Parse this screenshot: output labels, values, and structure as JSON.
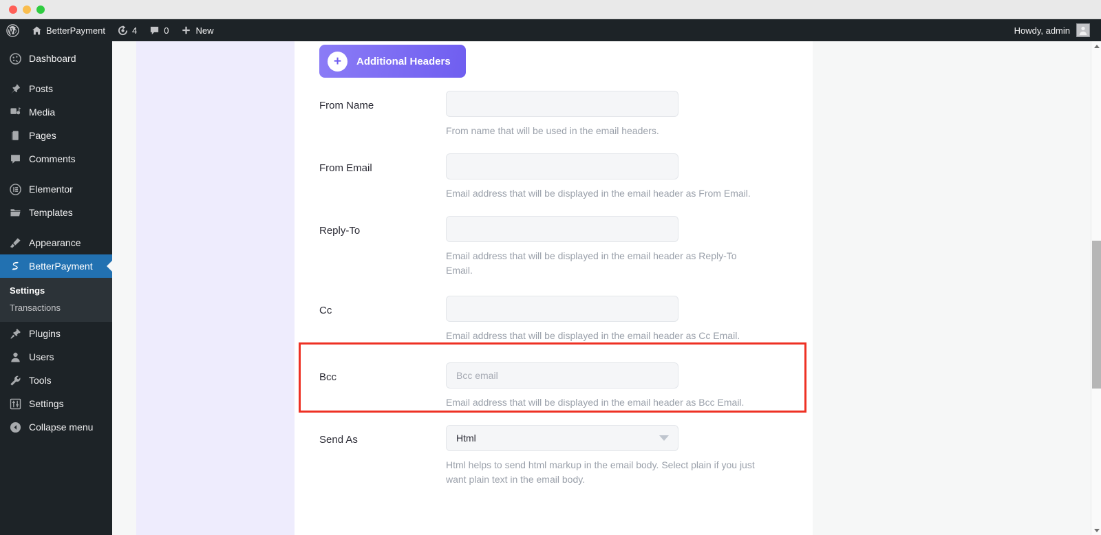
{
  "window": {
    "controls": [
      "close",
      "minimize",
      "zoom"
    ]
  },
  "adminbar": {
    "wp_logo": "wordpress-logo-icon",
    "site_name": "BetterPayment",
    "site_icon": "home-icon",
    "updates_icon": "updates-icon",
    "updates_count": "4",
    "comments_icon": "comment-icon",
    "comments_count": "0",
    "new_icon": "plus-icon",
    "new_label": "New",
    "greeting": "Howdy, admin",
    "avatar_icon": "avatar-icon"
  },
  "sidebar": {
    "items": [
      {
        "label": "Dashboard",
        "icon": "dashboard-icon",
        "active": false
      },
      {
        "label": "Posts",
        "icon": "pin-icon",
        "active": false
      },
      {
        "label": "Media",
        "icon": "media-icon",
        "active": false
      },
      {
        "label": "Pages",
        "icon": "pages-icon",
        "active": false
      },
      {
        "label": "Comments",
        "icon": "comment-icon",
        "active": false
      },
      {
        "label": "Elementor",
        "icon": "elementor-icon",
        "active": false
      },
      {
        "label": "Templates",
        "icon": "folder-icon",
        "active": false
      },
      {
        "label": "Appearance",
        "icon": "brush-icon",
        "active": false
      },
      {
        "label": "BetterPayment",
        "icon": "betterpayment-icon",
        "active": true
      },
      {
        "label": "Plugins",
        "icon": "plug-icon",
        "active": false
      },
      {
        "label": "Users",
        "icon": "user-icon",
        "active": false
      },
      {
        "label": "Tools",
        "icon": "wrench-icon",
        "active": false
      },
      {
        "label": "Settings",
        "icon": "sliders-icon",
        "active": false
      },
      {
        "label": "Collapse menu",
        "icon": "collapse-icon",
        "active": false
      }
    ],
    "submenu": [
      {
        "label": "Settings",
        "current": true
      },
      {
        "label": "Transactions",
        "current": false
      }
    ],
    "active_color": "#2271b1",
    "bg_color": "#1d2327"
  },
  "main": {
    "headers_button": {
      "label": "Additional Headers",
      "icon": "plus-icon",
      "color": "#6f5ef0"
    },
    "fields": [
      {
        "label": "From Name",
        "type": "text",
        "value": "",
        "placeholder": "",
        "helper": "From name that will be used in the email headers."
      },
      {
        "label": "From Email",
        "type": "text",
        "value": "",
        "placeholder": "",
        "helper": "Email address that will be displayed in the email header as From Email."
      },
      {
        "label": "Reply-To",
        "type": "text",
        "value": "",
        "placeholder": "",
        "helper": "Email address that will be displayed in the email header as Reply-To Email."
      },
      {
        "label": "Cc",
        "type": "text",
        "value": "",
        "placeholder": "",
        "helper": "Email address that will be displayed in the email header as Cc Email.",
        "highlighted": true
      },
      {
        "label": "Bcc",
        "type": "text",
        "value": "",
        "placeholder": "Bcc email",
        "helper": "Email address that will be displayed in the email header as Bcc Email."
      },
      {
        "label": "Send As",
        "type": "select",
        "value": "Html",
        "placeholder": "",
        "helper": "Html helps to send html markup in the email body. Select plain if you just want plain text in the email body."
      }
    ]
  },
  "annotation": {
    "highlight_color": "#ee3124",
    "target_field": "Cc"
  },
  "scrollbar": {
    "up_icon": "scroll-up-arrow-icon",
    "down_icon": "scroll-down-arrow-icon"
  }
}
